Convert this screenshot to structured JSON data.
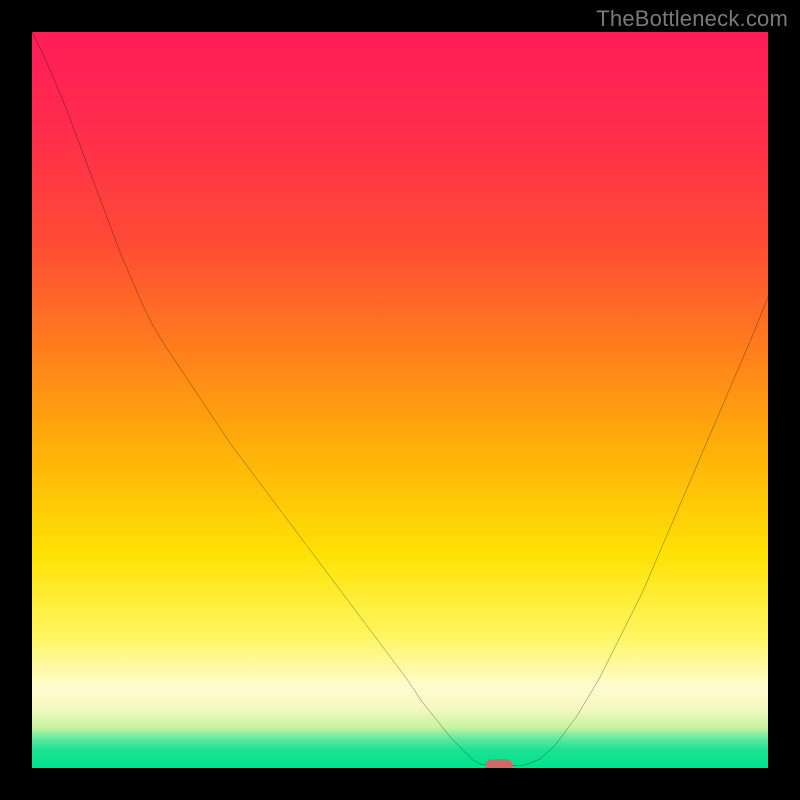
{
  "attribution": "TheBottleneck.com",
  "colors": {
    "background": "#000000",
    "curve_stroke": "#000000",
    "marker_fill": "#cf6a6b",
    "gradient_top": "#ff1d58",
    "gradient_bottom": "#00e28e"
  },
  "chart_data": {
    "type": "line",
    "title": "",
    "xlabel": "",
    "ylabel": "",
    "xlim": [
      0,
      100
    ],
    "ylim": [
      0,
      100
    ],
    "x": [
      0,
      1.5,
      3,
      4.5,
      6,
      7.5,
      9,
      10.5,
      12,
      13.5,
      15,
      16.5,
      18,
      21,
      24,
      27,
      30,
      33,
      36,
      39,
      42,
      45,
      48,
      51,
      53,
      55,
      57,
      59,
      60,
      61,
      63,
      65,
      67,
      69,
      71,
      74,
      77,
      80,
      83,
      86,
      89,
      92,
      95,
      98,
      100
    ],
    "values": [
      100,
      97,
      93.5,
      90,
      86,
      82,
      78,
      74,
      70,
      66.5,
      63,
      60,
      57.5,
      53,
      48.5,
      44,
      40,
      36,
      32,
      28,
      24,
      20,
      16,
      12,
      9,
      6.5,
      4,
      2,
      1,
      0.5,
      0.3,
      0.3,
      0.4,
      1.2,
      3,
      7,
      12,
      18,
      24,
      31,
      38,
      45,
      52,
      59,
      64
    ],
    "flat_bottom_range_x": [
      60,
      67
    ],
    "marker": {
      "x": 63.5,
      "y": 0.3
    },
    "grid": false,
    "legend": false
  }
}
